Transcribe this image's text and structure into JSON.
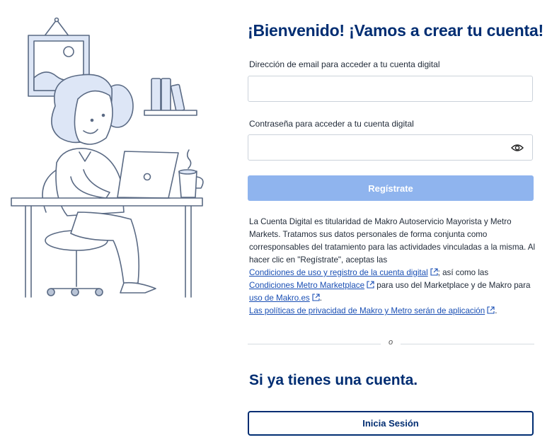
{
  "title": "¡Bienvenido! ¡Vamos a crear tu cuenta!",
  "email": {
    "label": "Dirección de email para acceder a tu cuenta digital",
    "value": "",
    "placeholder": ""
  },
  "password": {
    "label": "Contraseña para acceder a tu cuenta digital",
    "value": "",
    "placeholder": "",
    "toggle_icon": "eye-icon"
  },
  "submit_label": "Regístrate",
  "legal": {
    "line1": "La Cuenta Digital es titularidad de Makro Autoservicio Mayorista y Metro",
    "line2": "Markets. Tratamos sus datos personales de forma conjunta como",
    "line3": "corresponsables del tratamiento para las actividades vinculadas a la misma. Al",
    "line4": "hacer clic en \"Regístrate\", aceptas las",
    "link_terms": "Condiciones de uso y registro de la cuenta digital",
    "after_terms": "; así como las",
    "link_marketplace": "Condiciones Metro Marketplace",
    "after_marketplace": " para uso del Marketplace y de Makro para",
    "link_makro": "uso de Makro.es",
    "after_makro": ".",
    "link_privacy": "Las políticas de privacidad de Makro y Metro serán de aplicación",
    "after_privacy": "."
  },
  "divider_text": "o",
  "subtitle": "Si ya tienes una cuenta.",
  "login_label": "Inicia Sesión",
  "colors": {
    "brand": "#002d72",
    "submit_disabled": "#8fb4ee",
    "link": "#1a4fb4",
    "illustration": "#dde6f6"
  }
}
